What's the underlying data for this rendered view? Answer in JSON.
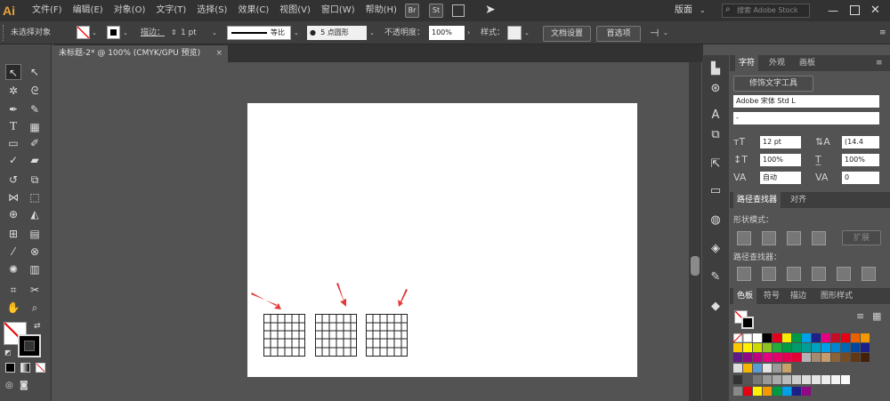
{
  "app": {
    "logo": "Ai",
    "title": "Adobe Illustrator"
  },
  "menu": [
    "文件(F)",
    "编辑(E)",
    "对象(O)",
    "文字(T)",
    "选择(S)",
    "效果(C)",
    "视图(V)",
    "窗口(W)",
    "帮助(H)"
  ],
  "menubar": {
    "br": "Br",
    "st": "St",
    "workspace": "版面",
    "search_placeholder": "搜索 Adobe Stock"
  },
  "control": {
    "status": "未选择对象",
    "stroke_label": "描边：",
    "stroke_value": "1 pt",
    "profile": "等比",
    "brush": "5 点圆形",
    "opacity_label": "不透明度：",
    "opacity": "100%",
    "style_label": "样式：",
    "doc_setup": "文档设置",
    "prefs": "首选项"
  },
  "doc_tab": {
    "title": "未标题-2* @ 100% (CMYK/GPU 预览)",
    "close": "×"
  },
  "char_panel": {
    "tabs": [
      "字符",
      "外观",
      "画板"
    ],
    "touch_type": "修饰文字工具",
    "font": "Adobe 宋体 Std L",
    "style": "-",
    "size": "12 pt",
    "leading": "(14.4",
    "vscale": "100%",
    "hscale": "100%",
    "kerning": "自动",
    "tracking": "0"
  },
  "pathfinder": {
    "tabs": [
      "路径查找器",
      "对齐"
    ],
    "shape_modes": "形状模式：",
    "expand": "扩展",
    "pathfinders": "路径查找器："
  },
  "swatches": {
    "tabs": [
      "色板",
      "符号",
      "描边",
      "图形样式"
    ]
  },
  "colors": {
    "menubar": "#323232",
    "panel": "#535353",
    "accent": "#e8a33d",
    "arrow": "#e23a3a"
  }
}
